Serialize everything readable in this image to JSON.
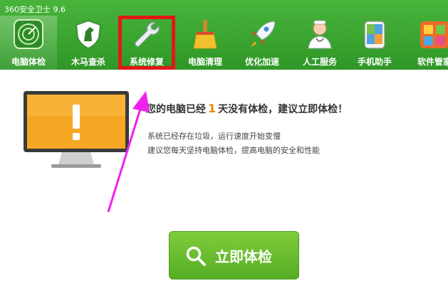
{
  "window": {
    "title": "360安全卫士 9.6"
  },
  "nav": {
    "tabs": [
      {
        "label": "电脑体检",
        "icon": "radar-icon"
      },
      {
        "label": "木马查杀",
        "icon": "horse-shield-icon"
      },
      {
        "label": "系统修复",
        "icon": "wrench-icon"
      },
      {
        "label": "电脑清理",
        "icon": "broom-icon"
      },
      {
        "label": "优化加速",
        "icon": "rocket-icon"
      },
      {
        "label": "人工服务",
        "icon": "doctor-icon"
      },
      {
        "label": "手机助手",
        "icon": "phone-icon"
      },
      {
        "label": "软件管家",
        "icon": "apps-icon"
      }
    ]
  },
  "main": {
    "msg_prefix": "您的电脑已经",
    "days": "1",
    "msg_suffix": "天没有体检，建议立即体检！",
    "line1": "系统已经存在垃圾，运行速度开始变慢",
    "line2": "建议您每天坚持电脑体检，提高电脑的安全和性能",
    "button_label": "立即体检"
  },
  "colors": {
    "topbar": "#3aa52f",
    "highlight": "#e21818",
    "arrow": "#ee22ee",
    "button": "#6cbd2e",
    "accent": "#e98a00"
  }
}
